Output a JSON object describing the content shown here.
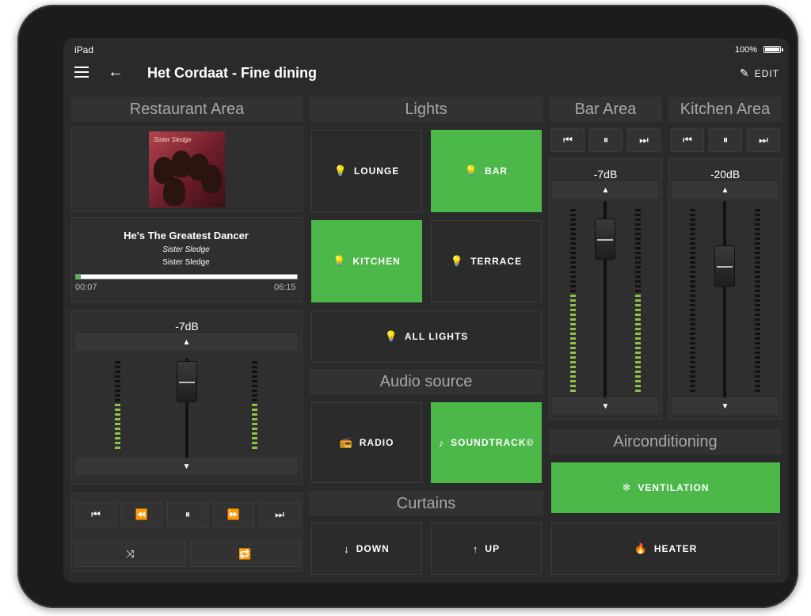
{
  "status": {
    "device": "iPad",
    "battery": "100%"
  },
  "header": {
    "title": "Het Cordaat - Fine dining",
    "edit_label": "EDIT"
  },
  "restaurant": {
    "title": "Restaurant Area",
    "album_caption": "Sister Sledge",
    "track": {
      "title": "He's The Greatest Dancer",
      "album": "Sister Sledge",
      "artist": "Sister Sledge",
      "elapsed": "00:07",
      "duration": "06:15",
      "progress": 0.02
    },
    "volume": "-7dB",
    "transport": [
      "⏮",
      "⏪",
      "⏸",
      "⏩",
      "⏭"
    ],
    "shuffle_icon": "⤨",
    "repeat_icon": "🔁"
  },
  "lights": {
    "title": "Lights",
    "items": [
      {
        "label": "LOUNGE",
        "on": false
      },
      {
        "label": "BAR",
        "on": true
      },
      {
        "label": "KITCHEN",
        "on": true
      },
      {
        "label": "TERRACE",
        "on": false
      }
    ],
    "all_label": "ALL LIGHTS"
  },
  "audio_source": {
    "title": "Audio source",
    "items": [
      {
        "label": "RADIO",
        "icon": "radio-icon",
        "on": false
      },
      {
        "label": "SOUNDTRACK©",
        "icon": "music-note-icon",
        "on": true
      }
    ]
  },
  "curtains": {
    "title": "Curtains",
    "down_label": "DOWN",
    "up_label": "UP"
  },
  "bar_area": {
    "title": "Bar Area",
    "volume": "-7dB"
  },
  "kitchen_area": {
    "title": "Kitchen Area",
    "volume": "-20dB"
  },
  "aircon": {
    "title": "Airconditioning",
    "ventilation_label": "VENTILATION",
    "heater_label": "HEATER"
  },
  "colors": {
    "accent": "#4cb84a",
    "background": "#2a2a2a",
    "meter": "#8bc34a"
  }
}
